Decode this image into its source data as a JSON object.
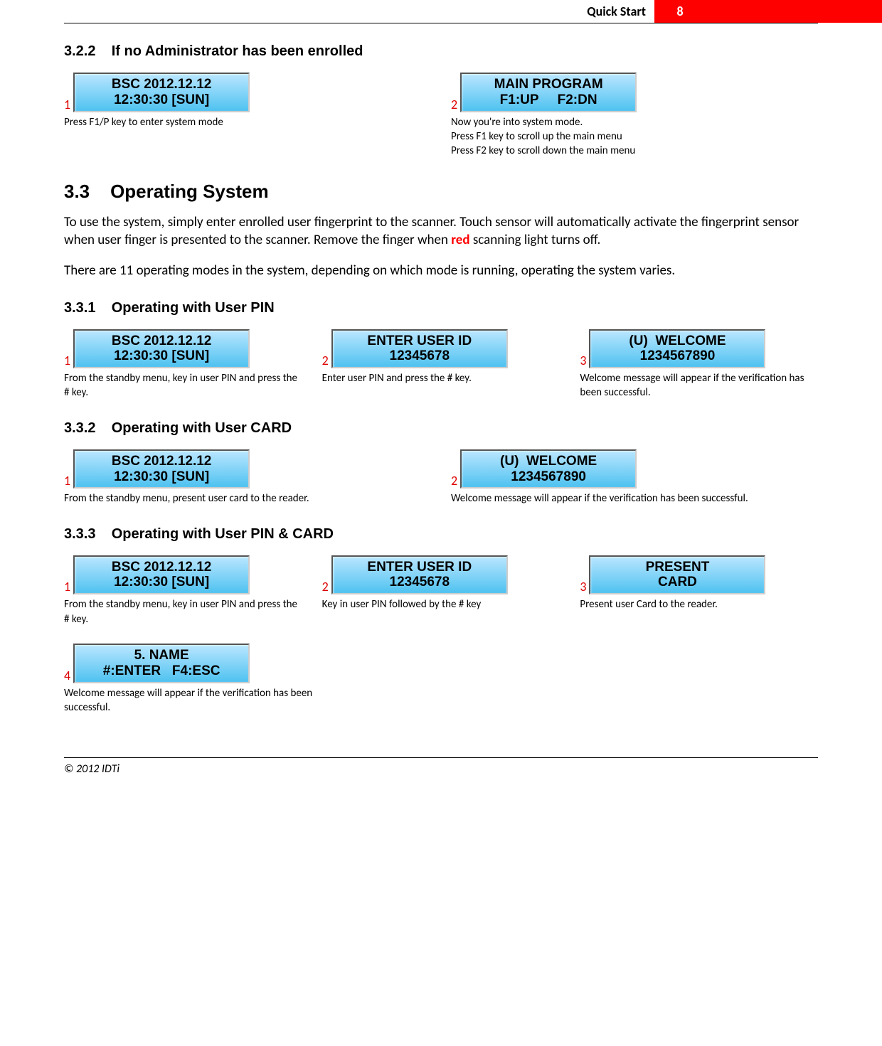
{
  "header": {
    "label": "Quick Start",
    "page": "8"
  },
  "s322": {
    "num": "3.2.2",
    "title": "If no Administrator has been enrolled",
    "steps": [
      {
        "n": "1",
        "lcd": [
          "BSC 2012.12.12",
          "12:30:30 [SUN]"
        ],
        "cap": "Press F1/P key to enter system mode"
      },
      {
        "n": "2",
        "lcd": [
          "MAIN PROGRAM",
          "F1:UP     F2:DN"
        ],
        "cap": "Now you're into system mode.\nPress F1 key to scroll up the main menu\nPress F2 key to scroll down the main menu"
      }
    ]
  },
  "s33": {
    "num": "3.3",
    "title": "Operating System",
    "p1a": "To use the system, simply enter enrolled user fingerprint to the scanner. Touch sensor will automatically activate the fingerprint sensor when user finger is presented to the scanner. Remove the finger when ",
    "p1red": "red",
    "p1b": " scanning light turns off.",
    "p2": "There are 11 operating modes in the system, depending on which mode is running, operating the system varies."
  },
  "s331": {
    "num": "3.3.1",
    "title": "Operating with User PIN",
    "steps": [
      {
        "n": "1",
        "lcd": [
          "BSC 2012.12.12",
          "12:30:30 [SUN]"
        ],
        "cap": "From the standby menu, key in user PIN and press the # key."
      },
      {
        "n": "2",
        "lcd": [
          "ENTER USER ID",
          "12345678"
        ],
        "cap": "Enter user PIN and press the # key."
      },
      {
        "n": "3",
        "lcd": [
          "(U)  WELCOME",
          "1234567890"
        ],
        "cap": "Welcome message will appear if the verification has been successful."
      }
    ]
  },
  "s332": {
    "num": "3.3.2",
    "title": "Operating with User CARD",
    "steps": [
      {
        "n": "1",
        "lcd": [
          "BSC 2012.12.12",
          "12:30:30 [SUN]"
        ],
        "cap": "From the standby menu, present user card to the reader."
      },
      {
        "n": "2",
        "lcd": [
          "(U)  WELCOME",
          "1234567890"
        ],
        "cap": "Welcome message will appear if the verification has been successful."
      }
    ]
  },
  "s333": {
    "num": "3.3.3",
    "title": "Operating with User PIN & CARD",
    "steps": [
      {
        "n": "1",
        "lcd": [
          "BSC 2012.12.12",
          "12:30:30 [SUN]"
        ],
        "cap": "From the standby menu, key in user PIN and press the # key."
      },
      {
        "n": "2",
        "lcd": [
          "ENTER USER ID",
          "12345678"
        ],
        "cap": "Key in user PIN followed by the # key"
      },
      {
        "n": "3",
        "lcd": [
          "PRESENT",
          "CARD"
        ],
        "cap": "Present user Card to the reader."
      },
      {
        "n": "4",
        "lcd": [
          "5. NAME",
          "#:ENTER   F4:ESC"
        ],
        "cap": "Welcome message will appear if the verification has been successful."
      }
    ]
  },
  "footer": "© 2012 IDTi"
}
